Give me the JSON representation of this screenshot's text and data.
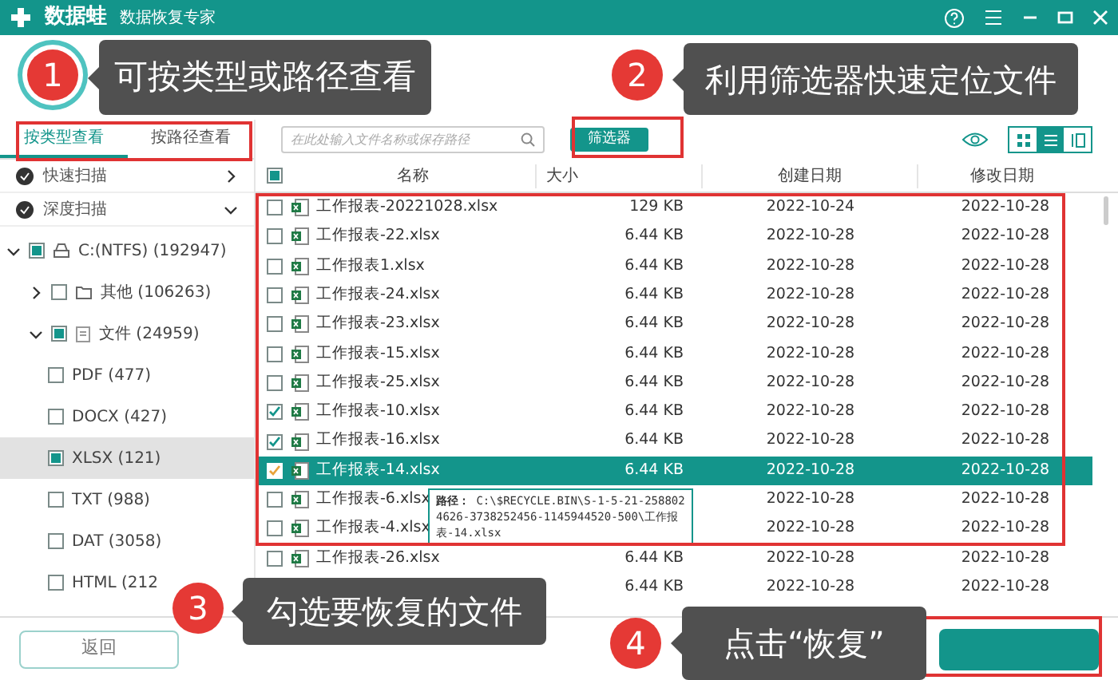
{
  "app": {
    "name": "数据蛙",
    "tagline": "数据恢复专家"
  },
  "view_tabs": [
    {
      "label": "按类型查看",
      "selected": true
    },
    {
      "label": "按路径查看",
      "selected": false
    }
  ],
  "search": {
    "placeholder": "在此处输入文件名称或保存路径"
  },
  "filter_button": "筛选器",
  "view_modes": [
    {
      "kind": "grid",
      "selected": false
    },
    {
      "kind": "list",
      "selected": true
    },
    {
      "kind": "columns",
      "selected": false
    }
  ],
  "scans": [
    {
      "label": "快速扫描",
      "expanded": false
    },
    {
      "label": "深度扫描",
      "expanded": true
    }
  ],
  "tree": [
    {
      "label": "C:(NTFS) (192947)",
      "kind": "drive",
      "checked": true,
      "expanded": true,
      "selected": false,
      "children": [
        {
          "label": "其他 (106263)",
          "kind": "folder",
          "checked": false,
          "expanded": false,
          "selected": false
        },
        {
          "label": "文件 (24959)",
          "kind": "files",
          "checked": true,
          "expanded": true,
          "selected": false,
          "children": [
            {
              "label": "PDF (477)",
              "checked": false,
              "selected": false
            },
            {
              "label": "DOCX (427)",
              "checked": false,
              "selected": false
            },
            {
              "label": "XLSX (121)",
              "checked": true,
              "selected": true
            },
            {
              "label": "TXT (988)",
              "checked": false,
              "selected": false
            },
            {
              "label": "DAT (3058)",
              "checked": false,
              "selected": false
            },
            {
              "label": "HTML (212",
              "checked": false,
              "selected": false
            }
          ]
        }
      ]
    }
  ],
  "table": {
    "columns": [
      "名称",
      "大小",
      "创建日期",
      "修改日期"
    ],
    "header_checked": true,
    "rows": [
      {
        "name": "工作报表-20221028.xlsx",
        "size": "129 KB",
        "created": "2022-10-24",
        "modified": "2022-10-28",
        "checked": false,
        "selected": false
      },
      {
        "name": "工作报表-22.xlsx",
        "size": "6.44 KB",
        "created": "2022-10-28",
        "modified": "2022-10-28",
        "checked": false,
        "selected": false
      },
      {
        "name": "工作报表1.xlsx",
        "size": "6.44 KB",
        "created": "2022-10-28",
        "modified": "2022-10-28",
        "checked": false,
        "selected": false
      },
      {
        "name": "工作报表-24.xlsx",
        "size": "6.44 KB",
        "created": "2022-10-28",
        "modified": "2022-10-28",
        "checked": false,
        "selected": false
      },
      {
        "name": "工作报表-23.xlsx",
        "size": "6.44 KB",
        "created": "2022-10-28",
        "modified": "2022-10-28",
        "checked": false,
        "selected": false
      },
      {
        "name": "工作报表-15.xlsx",
        "size": "6.44 KB",
        "created": "2022-10-28",
        "modified": "2022-10-28",
        "checked": false,
        "selected": false
      },
      {
        "name": "工作报表-25.xlsx",
        "size": "6.44 KB",
        "created": "2022-10-28",
        "modified": "2022-10-28",
        "checked": false,
        "selected": false
      },
      {
        "name": "工作报表-10.xlsx",
        "size": "6.44 KB",
        "created": "2022-10-28",
        "modified": "2022-10-28",
        "checked": true,
        "selected": false
      },
      {
        "name": "工作报表-16.xlsx",
        "size": "6.44 KB",
        "created": "2022-10-28",
        "modified": "2022-10-28",
        "checked": true,
        "selected": false
      },
      {
        "name": "工作报表-14.xlsx",
        "size": "6.44 KB",
        "created": "2022-10-28",
        "modified": "2022-10-28",
        "checked": true,
        "selected": true
      },
      {
        "name": "工作报表-6.xlsx",
        "created": "2022-10-28",
        "modified": "2022-10-28",
        "checked": false,
        "selected": false
      },
      {
        "name": "工作报表-4.xlsx",
        "created": "2022-10-28",
        "modified": "2022-10-28",
        "checked": false,
        "selected": false
      },
      {
        "name": "工作报表-26.xlsx",
        "size": "6.44 KB",
        "created": "2022-10-28",
        "modified": "2022-10-28",
        "checked": false,
        "selected": false
      },
      {
        "size": "6.44 KB",
        "created": "2022-10-28",
        "modified": "2022-10-28",
        "selected": false
      }
    ]
  },
  "tooltip": {
    "label": "路径：",
    "path": "C:\\$RECYCLE.BIN\\S-1-5-21-2588024626-3738252456-1145944520-500\\工作报表-14.xlsx"
  },
  "back_button": "返回",
  "callouts": [
    {
      "number": "1",
      "text": "可按类型或路径查看"
    },
    {
      "number": "2",
      "text": "利用筛选器快速定位文件"
    },
    {
      "number": "3",
      "text": "勾选要恢复的文件"
    },
    {
      "number": "4",
      "text": "点击“恢复”"
    }
  ]
}
